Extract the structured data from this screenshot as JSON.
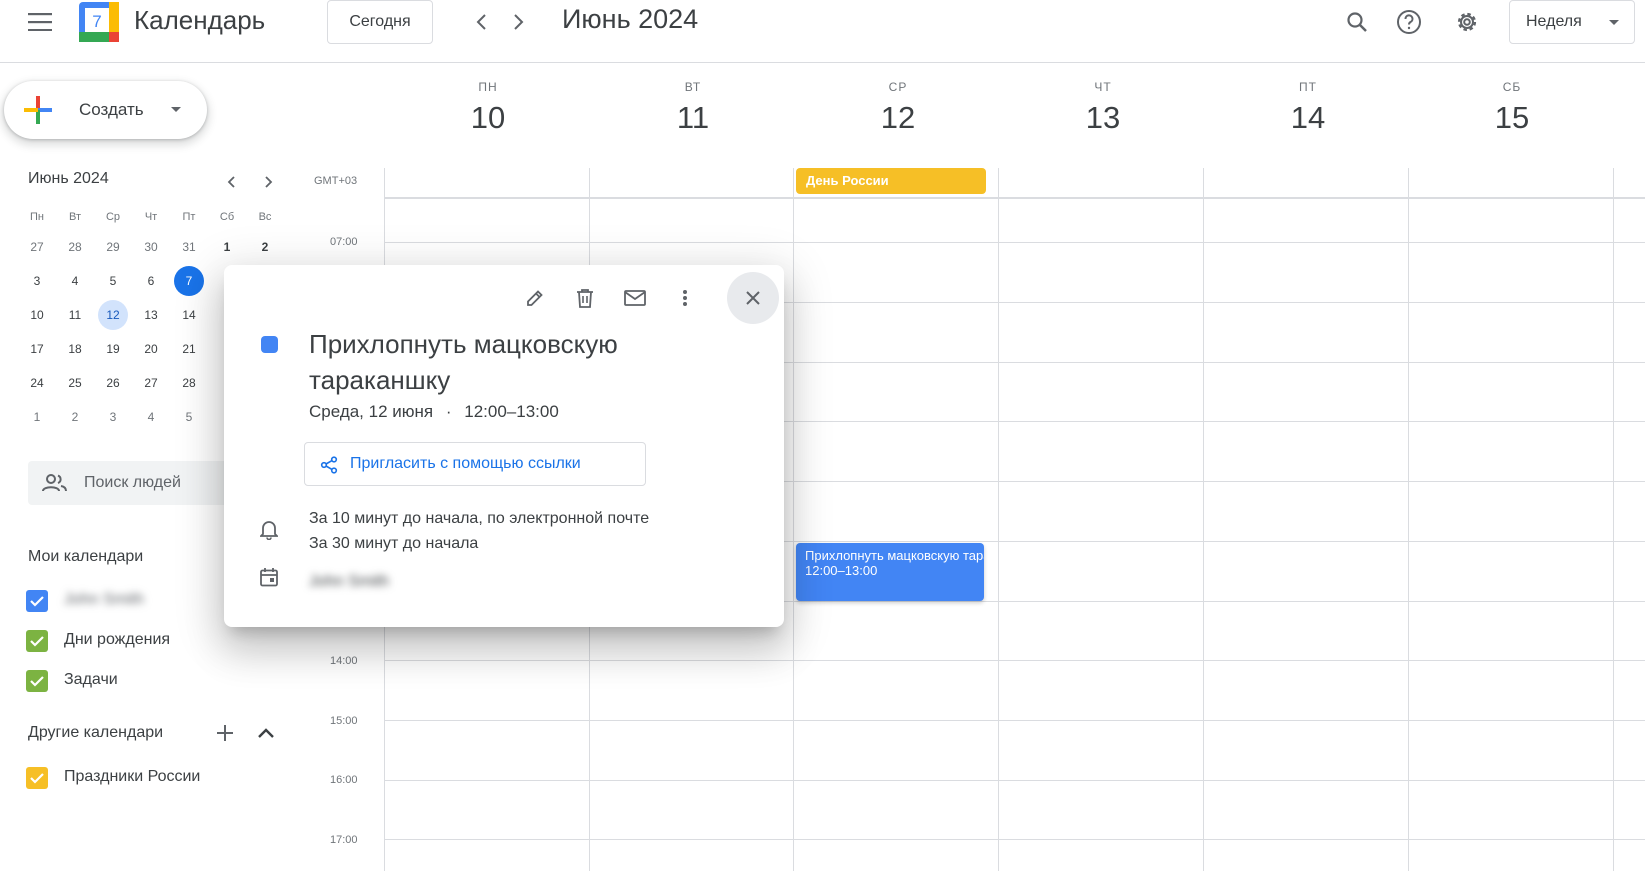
{
  "app": {
    "title": "Календарь",
    "logo_day": "7"
  },
  "header": {
    "today_label": "Сегодня",
    "period": "Июнь 2024",
    "view_label": "Неделя"
  },
  "sidebar": {
    "create_label": "Создать",
    "mini_calendar": {
      "title": "Июнь 2024",
      "weekdays": [
        "Пн",
        "Вт",
        "Ср",
        "Чт",
        "Пт",
        "Сб",
        "Вс"
      ],
      "weeks": [
        [
          "27",
          "28",
          "29",
          "30",
          "31",
          "1",
          "2"
        ],
        [
          "3",
          "4",
          "5",
          "6",
          "7",
          "",
          " "
        ],
        [
          "10",
          "11",
          "12",
          "13",
          "14",
          "",
          ""
        ],
        [
          "17",
          "18",
          "19",
          "20",
          "21",
          "",
          ""
        ],
        [
          "24",
          "25",
          "26",
          "27",
          "28",
          "",
          ""
        ],
        [
          "1",
          "2",
          "3",
          "4",
          "5",
          "",
          ""
        ]
      ]
    },
    "people_search_placeholder": "Поиск людей",
    "my_calendars_title": "Мои календари",
    "my_calendars": [
      {
        "label": "John Smith",
        "color": "#4285f4",
        "blurred": true
      },
      {
        "label": "Дни рождения",
        "color": "#7cb342"
      },
      {
        "label": "Задачи",
        "color": "#7cb342"
      }
    ],
    "other_calendars_title": "Другие календари",
    "other_calendars": [
      {
        "label": "Праздники России",
        "color": "#f6bf26"
      }
    ]
  },
  "week": {
    "timezone": "GMT+03",
    "days": [
      {
        "dow": "ПН",
        "num": "10"
      },
      {
        "dow": "ВТ",
        "num": "11"
      },
      {
        "dow": "СР",
        "num": "12"
      },
      {
        "dow": "ЧТ",
        "num": "13"
      },
      {
        "dow": "ПТ",
        "num": "14"
      },
      {
        "dow": "СБ",
        "num": "15"
      }
    ],
    "hours": [
      "07:00",
      "14:00",
      "15:00",
      "16:00",
      "17:00"
    ],
    "allday_event": {
      "title": "День России",
      "color": "#f6bf26"
    },
    "event": {
      "title": "Прихлопнуть мацковскую таракашку",
      "time": "12:00–13:00",
      "color": "#4285f4"
    }
  },
  "popup": {
    "title": "Прихлопнуть мацковскую тараканшку",
    "date": "Среда, 12 июня",
    "time": "12:00–13:00",
    "invite_label": "Пригласить с помощью ссылки",
    "reminders": [
      "За 10 минут до начала, по электронной почте",
      "За 30 минут до начала"
    ],
    "calendar_owner": "John Smith",
    "color": "#4285f4"
  }
}
